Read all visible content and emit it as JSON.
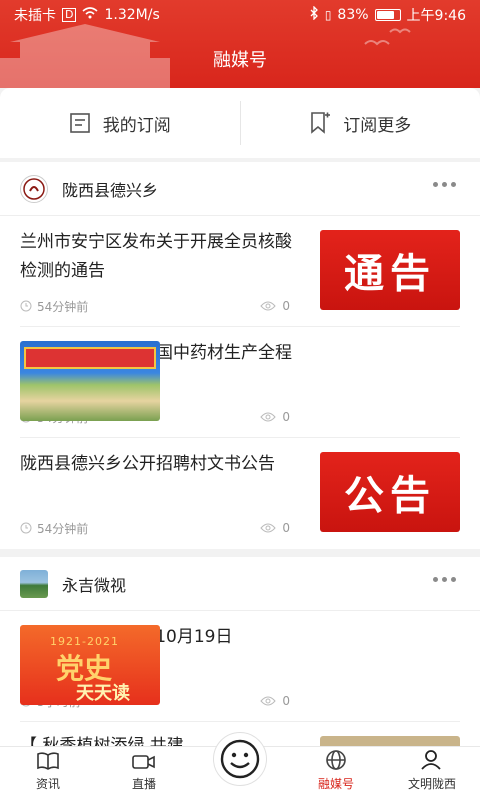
{
  "status": {
    "carrier": "未插卡",
    "speed": "1.32M/s",
    "battery": "83%",
    "battery_level": 0.83,
    "time": "上午9:46"
  },
  "header": {
    "title": "融媒号"
  },
  "subscription": {
    "my_label": "我的订阅",
    "more_label": "订阅更多"
  },
  "sections": [
    {
      "source": "陇西县德兴乡",
      "articles": [
        {
          "title": "兰州市安宁区发布关于开展全员核酸检测的通告",
          "time": "54分钟前",
          "views": "0",
          "thumb_text": "通告"
        },
        {
          "title": "农机地头展——全国中药材生产全程机械化推进大会…",
          "time": "54分钟前",
          "views": "0",
          "thumb_text": ""
        },
        {
          "title": "陇西县德兴乡公开招聘村文书公告",
          "time": "54分钟前",
          "views": "0",
          "thumb_text": "公告"
        }
      ]
    },
    {
      "source": "永吉微视",
      "articles": [
        {
          "title": "党史百年天天读 · 10月19日",
          "time": "5小时前",
          "views": "0",
          "thumb_year": "1921-2021",
          "thumb_big": "党史",
          "thumb_small": "天天读"
        },
        {
          "title": "【 秋季植树添绿 共建"
        }
      ]
    }
  ],
  "tabs": {
    "news": "资讯",
    "live": "直播",
    "media": "融媒号",
    "civil": "文明陇西"
  },
  "colors": {
    "brand": "#d8261c"
  }
}
